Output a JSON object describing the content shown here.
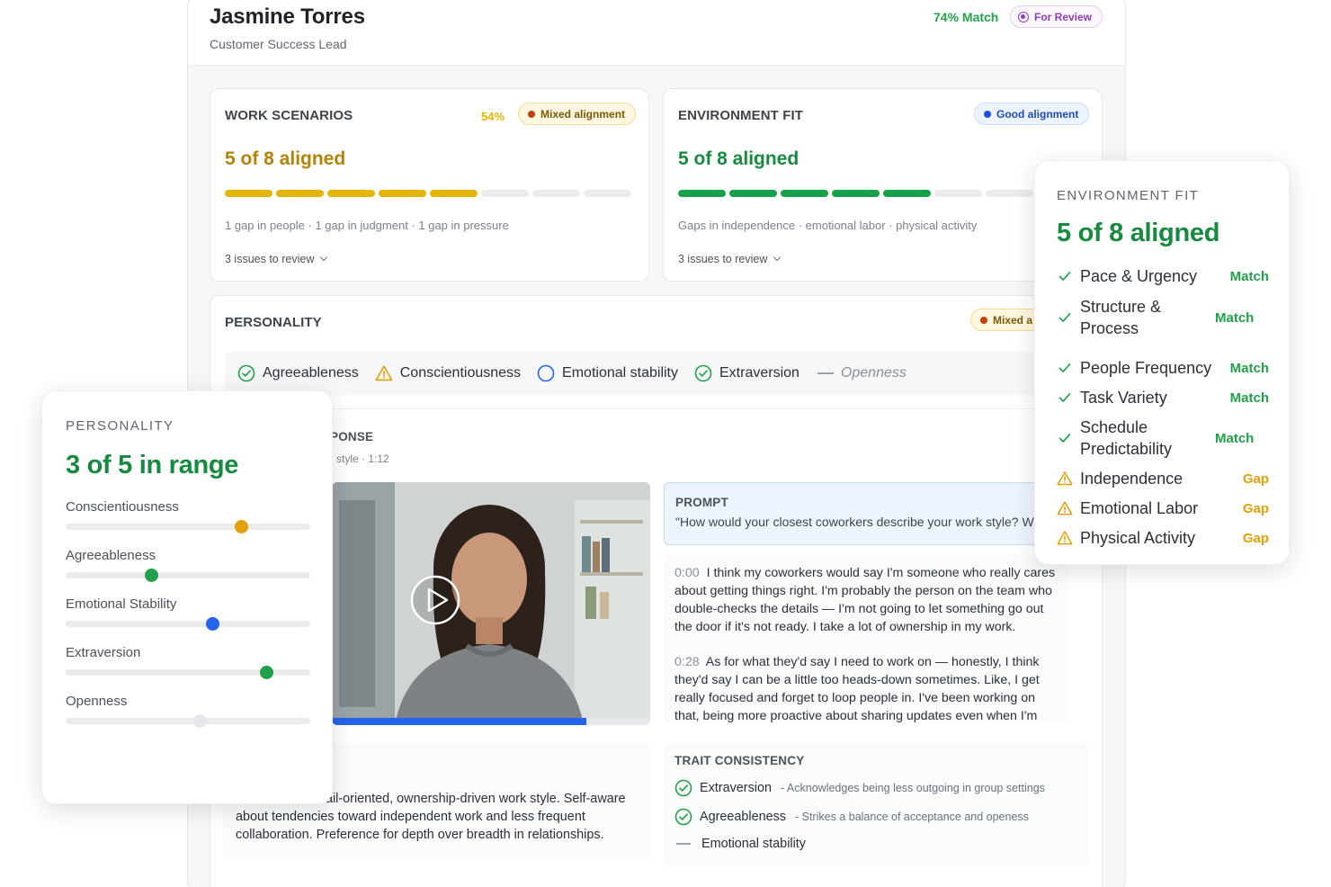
{
  "candidate": {
    "name": "Jasmine Torres",
    "role": "Customer Success Lead",
    "match": "74% Match",
    "review_status": "For Review"
  },
  "work_scenarios": {
    "title": "WORK SCENARIOS",
    "percent": "54%",
    "badge": "Mixed alignment",
    "stat": "5 of 8 aligned",
    "aligned": 5,
    "total": 8,
    "color": "#e3b505",
    "meta": "1 gap in people · 1 gap in judgment · 1 gap in pressure",
    "issues": "3 issues to review"
  },
  "environment_fit": {
    "title": "ENVIRONMENT FIT",
    "badge": "Good alignment",
    "stat": "5 of 8 aligned",
    "aligned": 5,
    "total": 8,
    "color": "#17a04a",
    "meta": "Gaps in independence · emotional labor · physical activity",
    "issues": "3 issues to review"
  },
  "personality": {
    "title": "PERSONALITY",
    "badge": "Mixed a",
    "traits": [
      {
        "label": "Agreeableness",
        "status": "check"
      },
      {
        "label": "Conscientiousness",
        "status": "warning"
      },
      {
        "label": "Emotional stability",
        "status": "circle"
      },
      {
        "label": "Extraversion",
        "status": "check"
      },
      {
        "label": "Openness",
        "status": "dash"
      }
    ]
  },
  "response": {
    "title_fragment": "PONSE",
    "meta_fragment": "style · 1:12",
    "progress": 0.8,
    "prompt_label": "PROMPT",
    "prompt_text": "\"How would your closest coworkers describe your work style? W",
    "transcript": [
      {
        "time": "0:00",
        "text": "I think my coworkers would say I'm someone who really cares about getting things right. I'm probably the person on the team who double-checks the details — I'm not going to let something go out the door if it's not ready. I take a lot of ownership in my work."
      },
      {
        "time": "0:28",
        "text": "As for what they'd say I need to work on — honestly, I think they'd say I can be a little too heads-down sometimes. Like, I get really focused and forget to loop people in. I've been working on that, being more proactive about sharing updates even when I'm"
      }
    ],
    "summary": "Describes a detail-oriented, ownership-driven work style. Self-aware about tendencies toward independent work and less frequent collaboration. Preference for depth over breadth in relationships."
  },
  "trait_consistency": {
    "title": "TRAIT CONSISTENCY",
    "rows": [
      {
        "name": "Extraversion",
        "note": "- Acknowledges being less outgoing in group settings",
        "status": "check"
      },
      {
        "name": "Agreeableness",
        "note": "- Strikes a balance of acceptance and openess",
        "status": "check"
      },
      {
        "name": "Emotional stability",
        "note": "",
        "status": "dash"
      }
    ]
  },
  "personality_card": {
    "title": "PERSONALITY",
    "stat": "3 of 5 in range",
    "sliders": [
      {
        "label": "Conscientiousness",
        "value": 0.72,
        "color": "#e3a008"
      },
      {
        "label": "Agreeableness",
        "value": 0.35,
        "color": "#22a04b"
      },
      {
        "label": "Emotional Stability",
        "value": 0.6,
        "color": "#2563eb"
      },
      {
        "label": "Extraversion",
        "value": 0.82,
        "color": "#22a04b"
      },
      {
        "label": "Openness",
        "value": 0.55,
        "color": "#e5e7eb"
      }
    ]
  },
  "environment_card": {
    "title": "ENVIRONMENT FIT",
    "stat": "5 of 8 aligned",
    "rows": [
      {
        "name": "Pace & Urgency",
        "status": "Match"
      },
      {
        "name": "Structure & Process",
        "status": "Match"
      },
      {
        "name": "People Frequency",
        "status": "Match"
      },
      {
        "name": "Task Variety",
        "status": "Match"
      },
      {
        "name": "Schedule Predictability",
        "status": "Match"
      },
      {
        "name": "Independence",
        "status": "Gap"
      },
      {
        "name": "Emotional Labor",
        "status": "Gap"
      },
      {
        "name": "Physical Activity",
        "status": "Gap"
      }
    ]
  },
  "colors": {
    "green": "#22a04b",
    "amber": "#e3a008",
    "blue": "#2563eb",
    "purple": "#8a3fbf"
  }
}
